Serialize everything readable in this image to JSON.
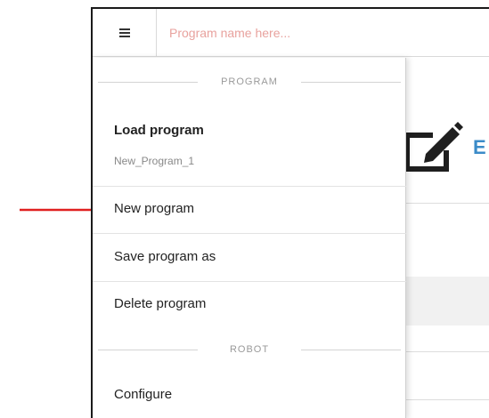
{
  "topbar": {
    "program_name_placeholder": "Program name here..."
  },
  "background": {
    "edit_text_partial": "E"
  },
  "menu": {
    "sections": {
      "program_header": "PROGRAM",
      "robot_header": "ROBOT"
    },
    "load_program": {
      "label": "Load program",
      "current_program": "New_Program_1"
    },
    "new_program": {
      "label": "New program"
    },
    "save_program_as": {
      "label": "Save program as"
    },
    "delete_program": {
      "label": "Delete program"
    },
    "configure": {
      "label": "Configure"
    }
  },
  "annotation": {
    "arrow_color": "#e02020",
    "icons": [
      "hamburger-menu-icon",
      "edit-pencil-icon"
    ]
  }
}
